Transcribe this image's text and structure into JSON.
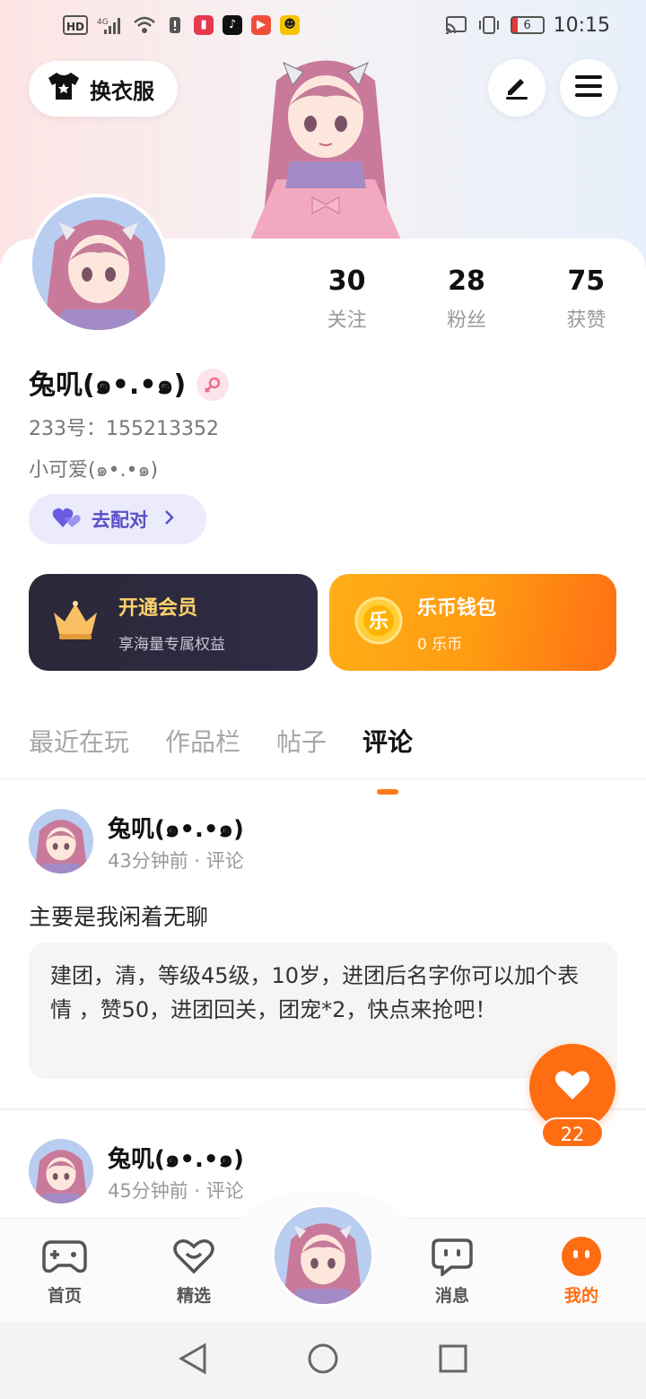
{
  "status_bar": {
    "hd": "HD",
    "network": "4G",
    "battery": "6",
    "time": "10:15"
  },
  "header": {
    "dress_button_label": "换衣服",
    "edit_icon": "pencil-icon",
    "menu_icon": "hamburger-icon"
  },
  "profile": {
    "stats": [
      {
        "value": "30",
        "label": "关注"
      },
      {
        "value": "28",
        "label": "粉丝"
      },
      {
        "value": "75",
        "label": "获赞"
      }
    ],
    "username": "兔叽(๑•.•๑)",
    "uid": "233号：155213352",
    "bio": "小可爱(๑•.•๑)",
    "match_button": "去配对"
  },
  "cards": {
    "vip_title": "开通会员",
    "vip_sub": "享海量专属权益",
    "wallet_title": "乐币钱包",
    "wallet_sub": "0 乐币",
    "wallet_coin_char": "乐"
  },
  "tabs": [
    "最近在玩",
    "作品栏",
    "帖子",
    "评论"
  ],
  "active_tab": "评论",
  "posts": [
    {
      "name": "兔叽(๑•.•๑)",
      "meta": "43分钟前 · 评论",
      "text": "主要是我闲着无聊",
      "quote": "建团，清，等级45级，10岁，进团后名字你可以加个表情 ，赞50，进团回关，团宠*2，快点来抢吧！"
    },
    {
      "name": "兔叽(๑•.•๑)",
      "meta": "45分钟前 · 评论"
    }
  ],
  "like": {
    "count": "22"
  },
  "bottom_nav": [
    {
      "label": "首页",
      "icon": "gamepad-icon"
    },
    {
      "label": "精选",
      "icon": "heart-icon"
    },
    {
      "label": "消息",
      "icon": "chat-icon"
    },
    {
      "label": "我的",
      "icon": "profile-icon"
    }
  ],
  "colors": {
    "accent": "#ff6d12",
    "match_text": "#5a50c8",
    "vip_bg": "#2a2838",
    "vip_title": "#ffd36a"
  }
}
